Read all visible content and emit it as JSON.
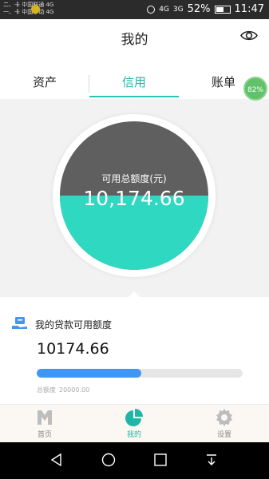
{
  "status_bar": {
    "carrier_line1": "二、卡 中国联通 4G",
    "carrier_line2": "一、卡 中国移动 4G",
    "net1": "4G",
    "net2": "3G",
    "battery": "52%",
    "time": "11:47"
  },
  "header": {
    "title": "我的",
    "icon": "eye-icon"
  },
  "tabs": [
    {
      "label": "资产",
      "active": false
    },
    {
      "label": "信用",
      "active": true
    },
    {
      "label": "账单",
      "active": false
    }
  ],
  "floating_badge": "82%",
  "gauge": {
    "label": "可用总额度(元)",
    "value": "10,174.66",
    "fill_fraction": 0.5,
    "colors": {
      "empty": "#5f5f5f",
      "fill": "#2fd9c1"
    }
  },
  "loan": {
    "title": "我的贷款可用额度",
    "amount": "10174.66",
    "progress_fraction": 0.5087,
    "total_label": "总额度",
    "total_value": "20000.00",
    "bar_color": "#3f96f5"
  },
  "bottom_nav": [
    {
      "label": "首页",
      "icon": "home-m-icon",
      "active": false
    },
    {
      "label": "我的",
      "icon": "pie-chart-icon",
      "active": true
    },
    {
      "label": "设置",
      "icon": "gear-icon",
      "active": false
    }
  ],
  "accent_color": "#1fb6a8"
}
